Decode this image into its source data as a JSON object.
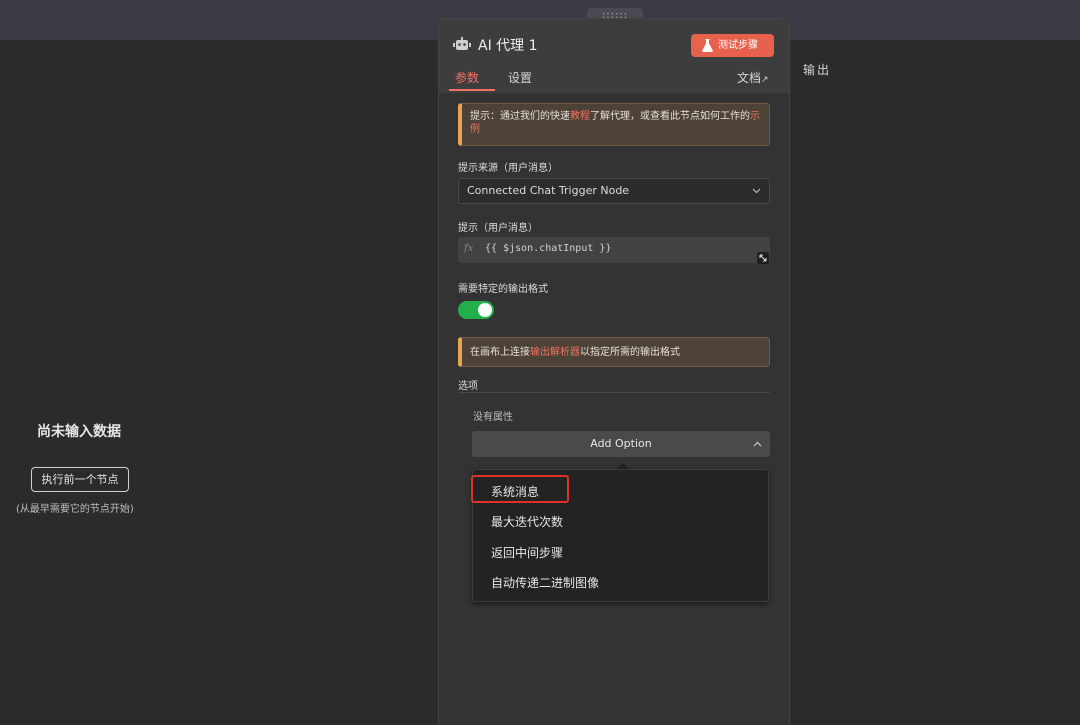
{
  "panel": {
    "title": "AI 代理 1",
    "test_step_label": "测试步骤",
    "tabs": [
      "参数",
      "设置"
    ],
    "docs_label": "文档",
    "drag_handle": "::::::"
  },
  "left": {
    "no_input_title": "尚未输入数据",
    "exec_prev_label": "执行前一个节点",
    "exec_prev_hint": "(从最早需要它的节点开始)"
  },
  "right": {
    "output_label": "输出"
  },
  "params": {
    "notice1": {
      "prefix": "提示：通过我们的快速",
      "link1": "教程",
      "middle": "了解代理，或查看此节点如何工作的",
      "link2": "示例"
    },
    "source_label": "提示来源（用户消息）",
    "source_value": "Connected Chat Trigger Node",
    "prompt_label": "提示（用户消息）",
    "prompt_fx": "fx",
    "prompt_value": "{{ $json.chatInput }}",
    "output_format_label": "需要特定的输出格式",
    "output_format_enabled": true,
    "notice2": {
      "prefix": "在画布上连接",
      "link": "输出解析器",
      "suffix": "以指定所需的输出格式"
    },
    "options_label": "选项",
    "no_props": "没有属性",
    "add_option_label": "Add Option"
  },
  "dropdown": {
    "items": [
      "系统消息",
      "最大迭代次数",
      "返回中间步骤",
      "自动传递二进制图像"
    ],
    "highlighted_index": 0
  },
  "colors": {
    "accent": "#f07260",
    "test_button": "#e8614d",
    "toggle_on": "#22b04b",
    "highlight_box": "#e0302a"
  }
}
